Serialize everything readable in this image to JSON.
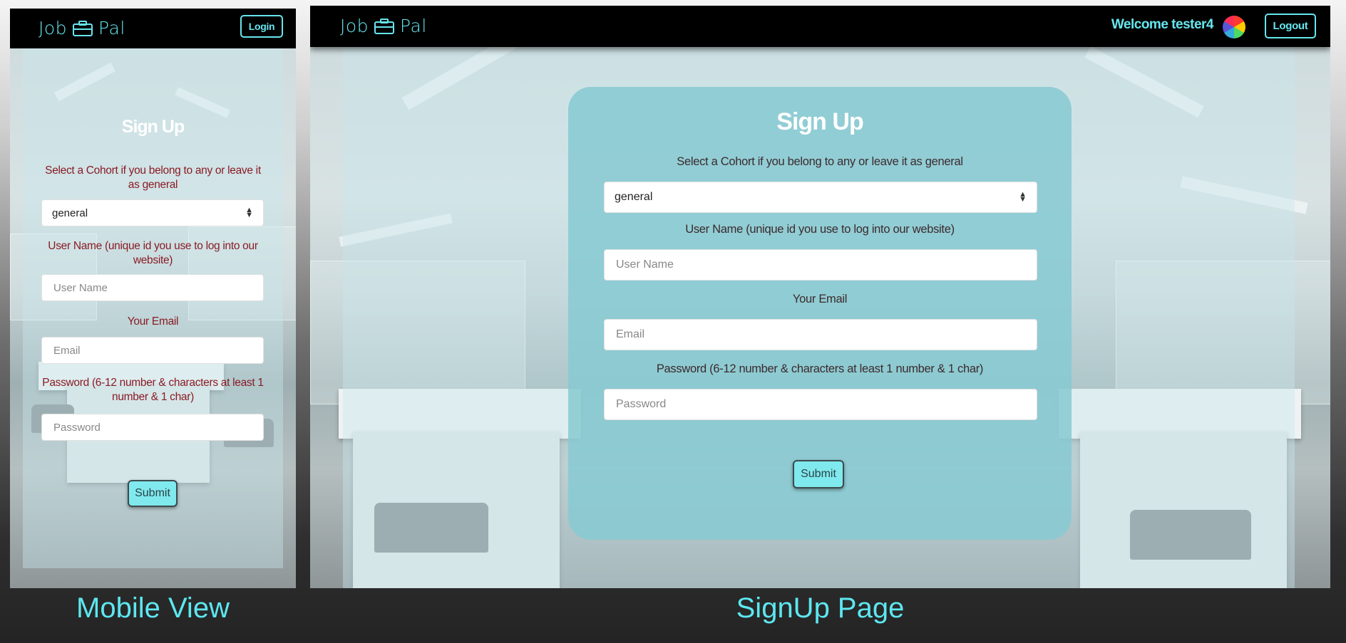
{
  "mobile": {
    "brand": {
      "left": "Job",
      "right": "Pal"
    },
    "login_label": "Login",
    "form": {
      "title": "Sign Up",
      "cohort_label": "Select a Cohort if you belong to any or leave it as general",
      "cohort_value": "general",
      "username_label": "User Name (unique id you use to log into our website)",
      "username_placeholder": "User Name",
      "email_label": "Your Email",
      "email_placeholder": "Email",
      "password_label": "Password (6-12 number & characters at least 1 number & 1 char)",
      "password_placeholder": "Password",
      "submit_label": "Submit"
    }
  },
  "desktop": {
    "brand": {
      "left": "Job",
      "right": "Pal"
    },
    "welcome": "Welcome tester4",
    "logout_label": "Logout",
    "form": {
      "title": "Sign Up",
      "cohort_label": "Select a Cohort if you belong to any or leave it as general",
      "cohort_value": "general",
      "username_label": "User Name (unique id you use to log into our website)",
      "username_placeholder": "User Name",
      "email_label": "Your Email",
      "email_placeholder": "Email",
      "password_label": "Password (6-12 number & characters at least 1 number & 1 char)",
      "password_placeholder": "Password",
      "submit_label": "Submit"
    }
  },
  "captions": {
    "mobile": "Mobile View",
    "desktop": "SignUp Page"
  },
  "icons": {
    "brand": "briefcase-icon",
    "select": "chevron-updown-icon",
    "avatar": "color-wheel-avatar"
  },
  "colors": {
    "accent": "#66e6ee",
    "card": "#87cad2",
    "label_mobile": "#8a1b25",
    "caption": "#5de7f0"
  }
}
